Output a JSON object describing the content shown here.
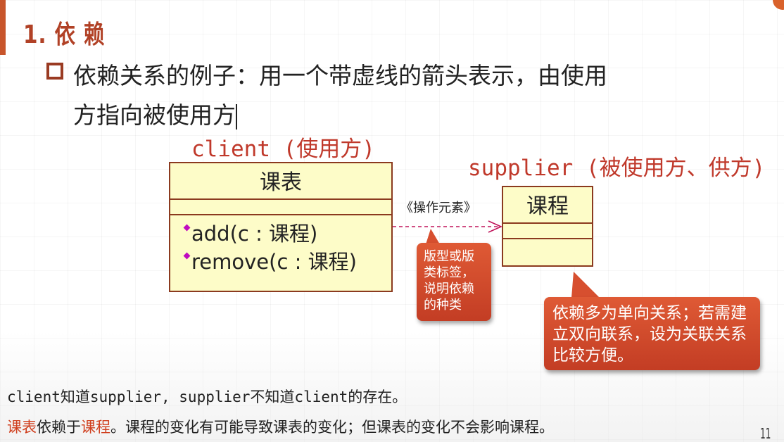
{
  "slide": {
    "title": "1. 依 赖",
    "bullet_line1": "依赖关系的例子：用一个带虚线的箭头表示，由使用",
    "bullet_line2": "方指向被使用方",
    "page_number": "11"
  },
  "diagram": {
    "client_label": "client (使用方)",
    "supplier_label": "supplier (被使用方、供方)",
    "client_class": {
      "name": "课表",
      "operations": [
        "add(c : 课程)",
        "remove(c : 课程)"
      ]
    },
    "supplier_class": {
      "name": "课程"
    },
    "stereotype": "《操作元素》",
    "dependency_color": "#c0145a"
  },
  "callouts": {
    "stereotype_note": "版型或版类标签，说明依赖的种类",
    "direction_note": "依赖多为单向关系；若需建立双向联系，设为关联关系比较方便。"
  },
  "notes": {
    "line1": "client知道supplier, supplier不知道client的存在。",
    "line2_part1": "课表",
    "line2_part2": "依赖于",
    "line2_part3": "课程",
    "line2_part4": "。课程的变化有可能导致课表的变化；但课表的变化不会影响课程。"
  },
  "colors": {
    "accent": "#b14126",
    "class_fill": "#fdfcc8",
    "callout": "#d2492b"
  }
}
